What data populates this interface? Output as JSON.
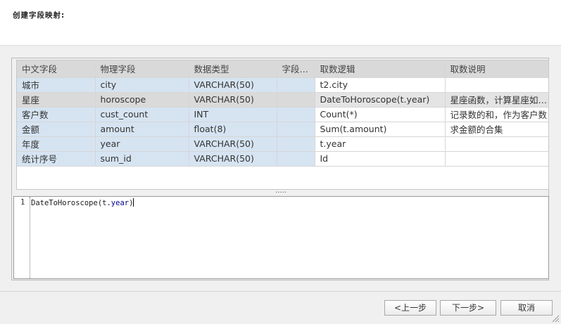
{
  "header": {
    "title": "创建字段映射:"
  },
  "table": {
    "columns": [
      "中文字段",
      "物理字段",
      "数据类型",
      "字段说...",
      "取数逻辑",
      "取数说明"
    ],
    "rows": [
      [
        "城市",
        "city",
        "VARCHAR(50)",
        "",
        "t2.city",
        ""
      ],
      [
        "星座",
        "horoscope",
        "VARCHAR(50)",
        "",
        "DateToHoroscope(t.year)",
        "星座函数，计算星座如何..."
      ],
      [
        "客户数",
        "cust_count",
        "INT",
        "",
        "Count(*)",
        "记录数的和，作为客户数"
      ],
      [
        "金额",
        "amount",
        "float(8)",
        "",
        "Sum(t.amount)",
        "求金额的合集"
      ],
      [
        "年度",
        "year",
        "VARCHAR(50)",
        "",
        "t.year",
        ""
      ],
      [
        "统计序号",
        "sum_id",
        "VARCHAR(50)",
        "",
        "Id",
        ""
      ]
    ],
    "selected_row": 1
  },
  "splitter": {
    "label": "....."
  },
  "editor": {
    "line_number": "1",
    "code_prefix": "DateToHoroscope(t.",
    "code_keyword": "year",
    "code_suffix": ")"
  },
  "buttons": {
    "prev": "<上一步",
    "next": "下一步>",
    "cancel": "取消"
  }
}
